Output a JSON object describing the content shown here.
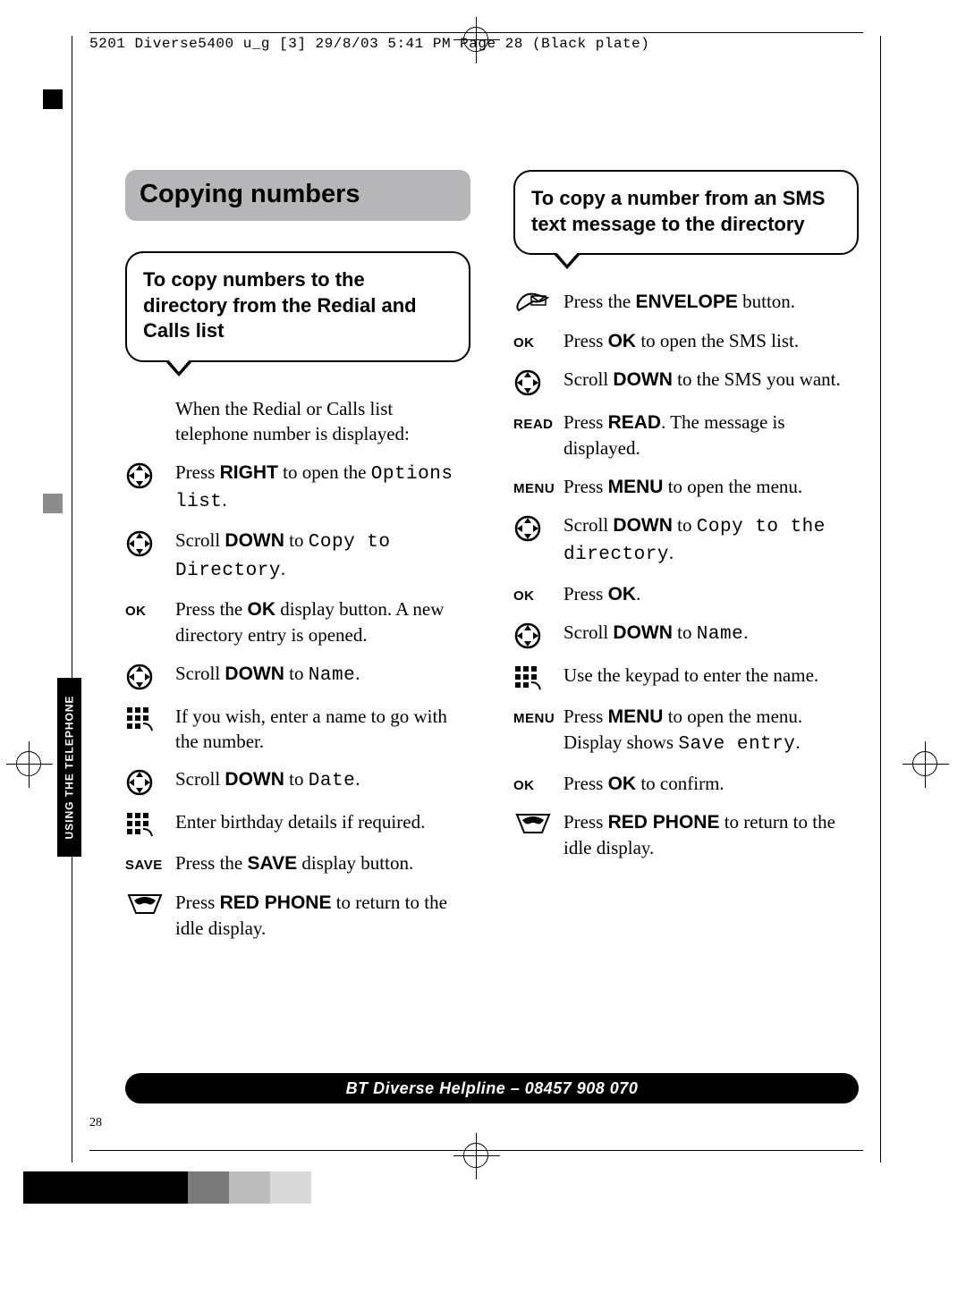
{
  "header": "5201 Diverse5400  u_g [3]  29/8/03  5:41 PM  Page 28   (Black plate)",
  "side_label": "USING THE TELEPHONE",
  "section_title": "Copying numbers",
  "left": {
    "callout": "To copy numbers to the directory from the Redial and Calls list",
    "intro": "When the Redial or Calls list telephone number is displayed:",
    "steps": [
      {
        "icon": "nav",
        "kw": "",
        "body": [
          [
            "",
            "Press "
          ],
          [
            "b",
            "RIGHT"
          ],
          [
            "",
            " to open the "
          ],
          [
            "lcd",
            "Options list"
          ],
          [
            "",
            "."
          ]
        ]
      },
      {
        "icon": "nav",
        "kw": "",
        "body": [
          [
            "",
            "Scroll "
          ],
          [
            "b",
            "DOWN"
          ],
          [
            "",
            " to "
          ],
          [
            "lcd",
            "Copy to Directory"
          ],
          [
            "",
            "."
          ]
        ]
      },
      {
        "icon": "",
        "kw": "OK",
        "body": [
          [
            "",
            "Press the "
          ],
          [
            "b",
            "OK"
          ],
          [
            "",
            " display button. A new directory entry is opened."
          ]
        ]
      },
      {
        "icon": "nav",
        "kw": "",
        "body": [
          [
            "",
            "Scroll "
          ],
          [
            "b",
            "DOWN"
          ],
          [
            "",
            " to "
          ],
          [
            "lcd",
            "Name"
          ],
          [
            "",
            "."
          ]
        ]
      },
      {
        "icon": "keypad",
        "kw": "",
        "body": [
          [
            "",
            "If you wish, enter a name to go with the number."
          ]
        ]
      },
      {
        "icon": "nav",
        "kw": "",
        "body": [
          [
            "",
            "Scroll "
          ],
          [
            "b",
            "DOWN"
          ],
          [
            "",
            " to "
          ],
          [
            "lcd",
            "Date"
          ],
          [
            "",
            "."
          ]
        ]
      },
      {
        "icon": "keypad",
        "kw": "",
        "body": [
          [
            "",
            "Enter birthday details if required."
          ]
        ]
      },
      {
        "icon": "",
        "kw": "SAVE",
        "body": [
          [
            "",
            "Press the "
          ],
          [
            "b",
            "SAVE"
          ],
          [
            "",
            " display button."
          ]
        ]
      },
      {
        "icon": "redphone",
        "kw": "",
        "body": [
          [
            "",
            "Press "
          ],
          [
            "b",
            "RED PHONE"
          ],
          [
            "",
            " to return to the idle display."
          ]
        ]
      }
    ]
  },
  "right": {
    "callout": "To copy a number from an SMS text message to the directory",
    "steps": [
      {
        "icon": "envelope",
        "kw": "",
        "body": [
          [
            "",
            "Press the "
          ],
          [
            "b",
            "ENVELOPE"
          ],
          [
            "",
            " button."
          ]
        ]
      },
      {
        "icon": "",
        "kw": "OK",
        "body": [
          [
            "",
            "Press "
          ],
          [
            "b",
            "OK"
          ],
          [
            "",
            " to open the SMS list."
          ]
        ]
      },
      {
        "icon": "nav",
        "kw": "",
        "body": [
          [
            "",
            "Scroll "
          ],
          [
            "b",
            "DOWN"
          ],
          [
            "",
            " to the SMS you want."
          ]
        ]
      },
      {
        "icon": "",
        "kw": "READ",
        "body": [
          [
            "",
            "Press "
          ],
          [
            "b",
            "READ"
          ],
          [
            "",
            ". The message is displayed."
          ]
        ]
      },
      {
        "icon": "",
        "kw": "MENU",
        "body": [
          [
            "",
            "Press "
          ],
          [
            "b",
            "MENU"
          ],
          [
            "",
            " to open the menu."
          ]
        ]
      },
      {
        "icon": "nav",
        "kw": "",
        "body": [
          [
            "",
            "Scroll "
          ],
          [
            "b",
            "DOWN"
          ],
          [
            "",
            " to "
          ],
          [
            "lcd",
            "Copy to the directory"
          ],
          [
            "",
            "."
          ]
        ]
      },
      {
        "icon": "",
        "kw": "OK",
        "body": [
          [
            "",
            "Press "
          ],
          [
            "b",
            "OK"
          ],
          [
            "",
            "."
          ]
        ]
      },
      {
        "icon": "nav",
        "kw": "",
        "body": [
          [
            "",
            "Scroll "
          ],
          [
            "b",
            "DOWN"
          ],
          [
            "",
            " to "
          ],
          [
            "lcd",
            "Name"
          ],
          [
            "",
            "."
          ]
        ]
      },
      {
        "icon": "keypad",
        "kw": "",
        "body": [
          [
            "",
            "Use the keypad to enter the name."
          ]
        ]
      },
      {
        "icon": "",
        "kw": "MENU",
        "body": [
          [
            "",
            "Press "
          ],
          [
            "b",
            "MENU"
          ],
          [
            "",
            " to open the menu. Display shows "
          ],
          [
            "lcd",
            "Save entry"
          ],
          [
            "",
            "."
          ]
        ]
      },
      {
        "icon": "",
        "kw": "OK",
        "body": [
          [
            "",
            "Press "
          ],
          [
            "b",
            "OK"
          ],
          [
            "",
            " to confirm."
          ]
        ]
      },
      {
        "icon": "redphone",
        "kw": "",
        "body": [
          [
            "",
            "Press "
          ],
          [
            "b",
            "RED PHONE"
          ],
          [
            "",
            " to return to the idle display."
          ]
        ]
      }
    ]
  },
  "footer": "BT Diverse Helpline – 08457 908 070",
  "page_number": "28",
  "swatches": [
    "#000000",
    "#000000",
    "#000000",
    "#000000",
    "#7a7a7a",
    "#bcbcbc",
    "#d9d9d9"
  ]
}
